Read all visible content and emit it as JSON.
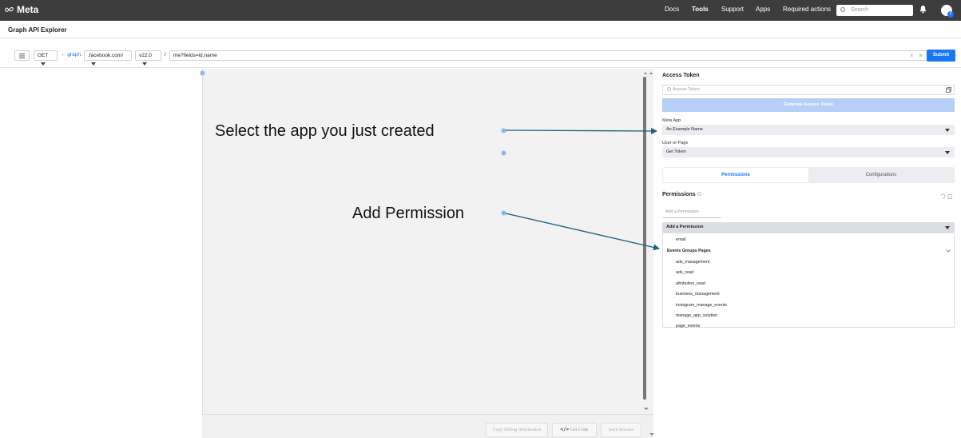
{
  "topbar": {
    "logo_text": "Meta",
    "nav": [
      "Docs",
      "Tools",
      "Support",
      "Apps",
      "Required actions"
    ],
    "active_nav": "Tools",
    "search_placeholder": "Search"
  },
  "page_title": "Graph API Explorer",
  "request": {
    "method": "GET",
    "host_prefix": "graph.",
    "host_suffix": ".facebook.com/",
    "version": "v22.0",
    "slash": "/",
    "path": "me?fields=id,name",
    "submit_label": "Submit",
    "clear_glyph": "×",
    "star_glyph": "★"
  },
  "editor_footer": {
    "copy_debug": "Copy Debug Information",
    "get_code": "Get Code",
    "save_session": "Save Session"
  },
  "annotations": {
    "select_app": "Select the app you just created",
    "add_permission": "Add Permission",
    "arrow_color": "#1f5f7e"
  },
  "panel": {
    "access_token_title": "Access Token",
    "access_token_placeholder": "Access Token",
    "generate_label": "Generate Access Token",
    "meta_app_label": "Meta App",
    "meta_app_value": "An Example Name",
    "user_or_page_label": "User or Page",
    "user_or_page_value": "Get Token",
    "tabs": [
      {
        "label": "Permissions",
        "active": true
      },
      {
        "label": "Configurations",
        "active": false
      }
    ],
    "permissions_title": "Permissions",
    "add_permission_placeholder": "Add a Permission",
    "add_permission_select": "Add a Permission",
    "dropdown": {
      "top_item": "email",
      "group_label": "Events Groups Pages",
      "items": [
        "ads_management",
        "ads_read",
        "attribution_read",
        "business_management",
        "instagram_manage_events",
        "manage_app_solution",
        "page_events"
      ]
    }
  },
  "colors": {
    "topbar": "#3d3d3d",
    "accent": "#1877f2",
    "generate_disabled": "#b5cff7"
  }
}
